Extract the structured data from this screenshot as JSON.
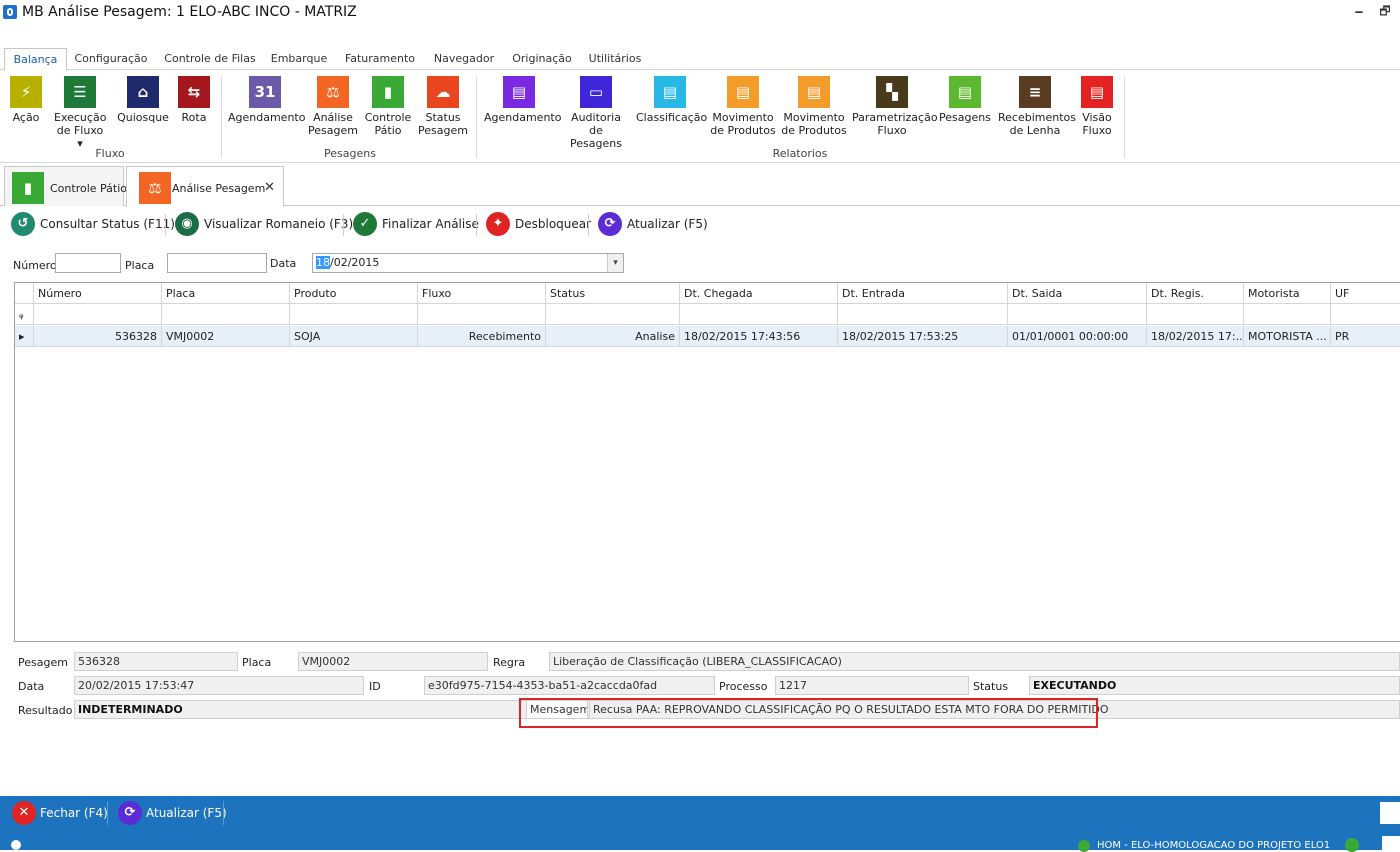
{
  "window": {
    "title": "MB Análise Pesagem: 1 ELO-ABC INCO - MATRIZ",
    "minimize": "🗕",
    "maximize": "🗗"
  },
  "menu_tabs": [
    "Balança",
    "Configuração",
    "Controle de Filas",
    "Embarque",
    "Faturamento",
    "Navegador",
    "Originação",
    "Utilitários"
  ],
  "ribbon": {
    "fluxo": {
      "group_label": "Fluxo",
      "buttons": [
        {
          "line1": "Ação",
          "line2": "",
          "color": "#b8b000",
          "icon": "lightning-icon",
          "glyph": "⚡"
        },
        {
          "line1": "Execução",
          "line2": "de Fluxo ▾",
          "color": "#1f7a3a",
          "icon": "list-icon",
          "glyph": "☰"
        },
        {
          "line1": "Quiosque",
          "line2": "",
          "color": "#1e2a6b",
          "icon": "kiosk-icon",
          "glyph": "⌂"
        },
        {
          "line1": "Rota",
          "line2": "",
          "color": "#a3171d",
          "icon": "route-icon",
          "glyph": "⇆"
        }
      ]
    },
    "pesagens": {
      "group_label": "Pesagens",
      "buttons": [
        {
          "line1": "Agendamento",
          "line2": "",
          "color": "#6c5aa8",
          "icon": "calendar-icon",
          "glyph": "31"
        },
        {
          "line1": "Análise",
          "line2": "Pesagem",
          "color": "#f26522",
          "icon": "gavel-icon",
          "glyph": "⚖"
        },
        {
          "line1": "Controle",
          "line2": "Pátio",
          "color": "#3aa935",
          "icon": "chart-icon",
          "glyph": "▮"
        },
        {
          "line1": "Status",
          "line2": "Pesagem",
          "color": "#e8461e",
          "icon": "cloud-sync-icon",
          "glyph": "☁"
        }
      ]
    },
    "relatorios": {
      "group_label": "Relatorios",
      "buttons": [
        {
          "line1": "Agendamento",
          "line2": "",
          "color": "#7a2be2",
          "icon": "calendar-report-icon",
          "glyph": "▤"
        },
        {
          "line1": "Auditoria",
          "line2": "de Pesagens",
          "color": "#3f26d6",
          "icon": "audit-icon",
          "glyph": "▭"
        },
        {
          "line1": "Classificação",
          "line2": "",
          "color": "#27b8e6",
          "icon": "document-icon",
          "glyph": "▤"
        },
        {
          "line1": "Movimento",
          "line2": "de Produtos",
          "color": "#f39c2a",
          "icon": "document-orange-icon",
          "glyph": "▤"
        },
        {
          "line1": "Movimento",
          "line2": "de Produtos",
          "color": "#f39c2a",
          "icon": "document-orange2-icon",
          "glyph": "▤"
        },
        {
          "line1": "Parametrização",
          "line2": "Fluxo",
          "color": "#4a3a1c",
          "icon": "checker-icon",
          "glyph": "▚"
        },
        {
          "line1": "Pesagens",
          "line2": "",
          "color": "#5cb82e",
          "icon": "document-green-icon",
          "glyph": "▤"
        },
        {
          "line1": "Recebimentos",
          "line2": "de Lenha",
          "color": "#5a3c22",
          "icon": "stack-icon",
          "glyph": "≡"
        },
        {
          "line1": "Visão",
          "line2": "Fluxo",
          "color": "#e52222",
          "icon": "document-red-icon",
          "glyph": "▤"
        }
      ]
    }
  },
  "doc_tabs": [
    {
      "label": "Controle Pátio",
      "color": "#3aa935",
      "glyph": "▮"
    },
    {
      "label": "Análise Pesagem",
      "color": "#f26522",
      "glyph": "⚖",
      "close": "✕"
    }
  ],
  "toolbar": [
    {
      "label": "Consultar Status (F11)",
      "color": "#1f8a6e",
      "glyph": "↺"
    },
    {
      "label": "Visualizar Romaneio (F3)",
      "color": "#1e6b4a",
      "glyph": "◉"
    },
    {
      "label": "Finalizar Análise",
      "color": "#1f7a3a",
      "glyph": "✓"
    },
    {
      "label": "Desbloquear",
      "color": "#e02424",
      "glyph": "✦"
    },
    {
      "label": "Atualizar (F5)",
      "color": "#5b2bd6",
      "glyph": "⟳"
    }
  ],
  "filters": {
    "numero_label": "Número",
    "numero_value": "",
    "placa_label": "Placa",
    "placa_value": "",
    "data_label": "Data",
    "data_selected": "18",
    "data_rest": "/02/2015",
    "dropdown": "▾"
  },
  "grid": {
    "columns": [
      "Número",
      "Placa",
      "Produto",
      "Fluxo",
      "Status",
      "Dt. Chegada",
      "Dt. Entrada",
      "Dt. Saida",
      "Dt. Regis.",
      "Motorista",
      "UF"
    ],
    "filter_icon": "ᵩ",
    "row_marker": "▸",
    "rows": [
      [
        "536328",
        "VMJ0002",
        "SOJA",
        "Recebimento",
        "Analise",
        "18/02/2015 17:43:56",
        "18/02/2015 17:53:25",
        "01/01/0001 00:00:00",
        "18/02/2015 17:...",
        "MOTORISTA ...",
        "PR"
      ]
    ]
  },
  "details": {
    "pesagem_label": "Pesagem",
    "pesagem": "536328",
    "placa_label": "Placa",
    "placa": "VMJ0002",
    "regra_label": "Regra",
    "regra": "Liberação de Classificação (LIBERA_CLASSIFICACAO)",
    "data_label": "Data",
    "data": "20/02/2015 17:53:47",
    "id_label": "ID",
    "id": "e30fd975-7154-4353-ba51-a2caccda0fad",
    "processo_label": "Processo",
    "processo": "1217",
    "status_label": "Status",
    "status": "EXECUTANDO",
    "resultado_label": "Resultado",
    "resultado": "INDETERMINADO",
    "mensagem_label": "Mensagem",
    "mensagem": "Recusa PAA: REPROVANDO CLASSIFICAÇÃO PQ O RESULTADO ESTA MTO FORA DO PERMITIDO"
  },
  "bottom_bar": [
    {
      "label": "Fechar (F4)",
      "color": "#e02424",
      "glyph": "✕"
    },
    {
      "label": "Atualizar (F5)",
      "color": "#5b2bd6",
      "glyph": "⟳"
    }
  ],
  "status_bar": {
    "text": "HOM - ELO-HOMOLOGACAO DO PROJETO ELO1"
  },
  "colors": {
    "accent": "#1e73be",
    "highlight_border": "#d9262a",
    "row_selected": "#e6f0fb"
  }
}
